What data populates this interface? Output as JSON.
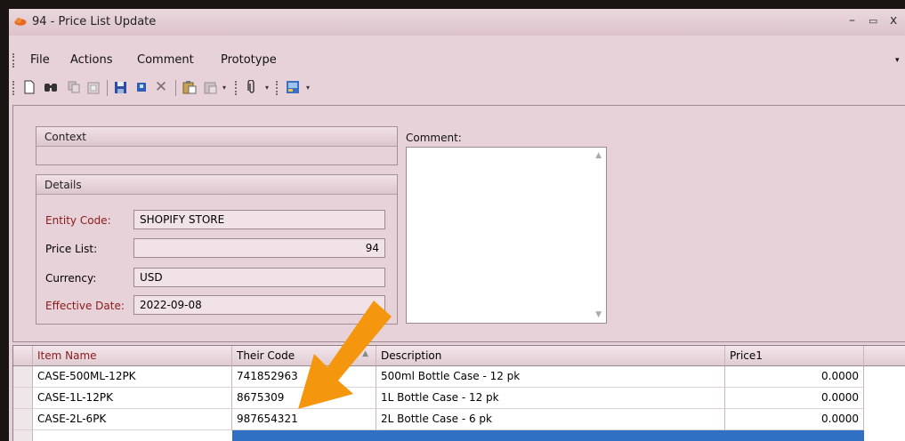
{
  "window": {
    "title": "94 - Price List Update",
    "minimize": "–",
    "maximize": "▭",
    "close": "x"
  },
  "menu": [
    "File",
    "Actions",
    "Comment",
    "Prototype"
  ],
  "menu_overflow": "▾",
  "toolbar_icons": [
    "new-document-icon",
    "find-icon",
    "copy-icon",
    "paste-icon",
    "save-icon",
    "save-small-icon",
    "delete-icon",
    "import-icon",
    "export-icon",
    "attach-icon",
    "report-icon"
  ],
  "context": {
    "header": "Context"
  },
  "details": {
    "header": "Details",
    "entity_code_label": "Entity Code:",
    "entity_code": "SHOPIFY STORE",
    "price_list_label": "Price List:",
    "price_list": "94",
    "currency_label": "Currency:",
    "currency": "USD",
    "effective_date_label": "Effective Date:",
    "effective_date": "2022-09-08"
  },
  "comment": {
    "label": "Comment:",
    "value": ""
  },
  "grid": {
    "columns": [
      "Item Name",
      "Their Code",
      "Description",
      "Price1"
    ],
    "rows": [
      {
        "item": "CASE-500ML-12PK",
        "code": "741852963",
        "desc": "500ml Bottle Case - 12 pk",
        "price": "0.0000"
      },
      {
        "item": "CASE-1L-12PK",
        "code": "8675309",
        "desc": "1L Bottle Case - 12 pk",
        "price": "0.0000"
      },
      {
        "item": "CASE-2L-6PK",
        "code": "987654321",
        "desc": "2L Bottle Case - 6 pk",
        "price": "0.0000"
      }
    ]
  },
  "colors": {
    "accent_label": "#8b1a1a",
    "selection": "#2f6fc4",
    "annotation_arrow": "#f5960f"
  }
}
